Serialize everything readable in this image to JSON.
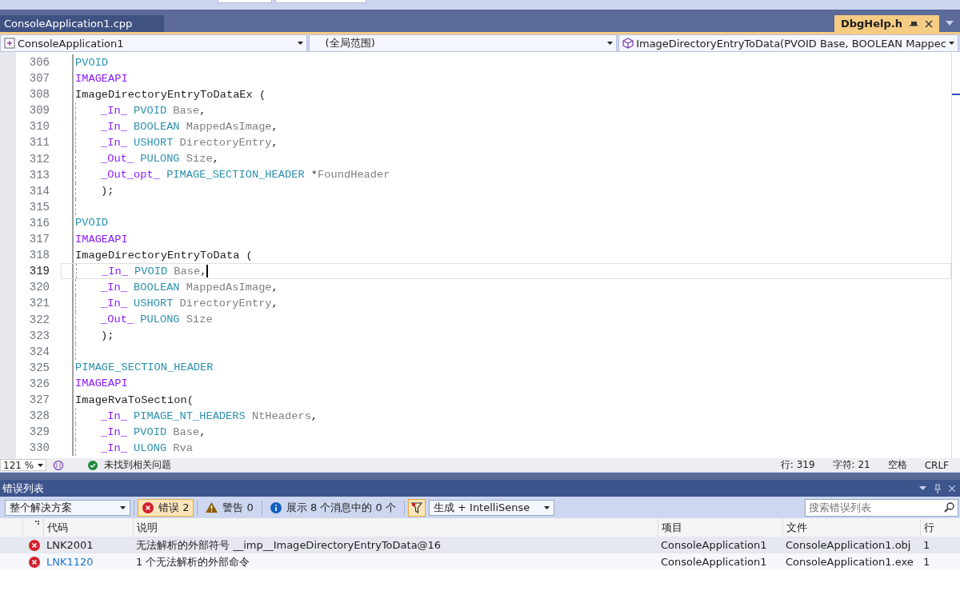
{
  "tabs": [
    {
      "label": "ConsoleApplication1.cpp",
      "selected": false
    },
    {
      "label": "DbgHelp.h",
      "selected": true
    }
  ],
  "navigation": {
    "project": "ConsoleApplication1",
    "scope": "(全局范围)",
    "member": "ImageDirectoryEntryToData(PVOID Base, BOOLEAN Mappec"
  },
  "code_lines": [
    {
      "number": "306",
      "current": false,
      "indented": false,
      "tokens": [
        {
          "kind": "type",
          "text": "PVOID"
        }
      ]
    },
    {
      "number": "307",
      "current": false,
      "indented": false,
      "tokens": [
        {
          "kind": "macro",
          "text": "IMAGEAPI"
        }
      ]
    },
    {
      "number": "308",
      "current": false,
      "indented": false,
      "tokens": [
        {
          "kind": "plain",
          "text": "ImageDirectoryEntryToDataEx ("
        }
      ]
    },
    {
      "number": "309",
      "current": false,
      "indented": true,
      "tokens": [
        {
          "kind": "macro",
          "text": "_In_"
        },
        {
          "kind": "type",
          "text": " PVOID"
        },
        {
          "kind": "param",
          "text": " Base"
        },
        {
          "kind": "plain",
          "text": ","
        }
      ]
    },
    {
      "number": "310",
      "current": false,
      "indented": true,
      "tokens": [
        {
          "kind": "macro",
          "text": "_In_"
        },
        {
          "kind": "type",
          "text": " BOOLEAN"
        },
        {
          "kind": "param",
          "text": " MappedAsImage"
        },
        {
          "kind": "plain",
          "text": ","
        }
      ]
    },
    {
      "number": "311",
      "current": false,
      "indented": true,
      "tokens": [
        {
          "kind": "macro",
          "text": "_In_"
        },
        {
          "kind": "type",
          "text": " USHORT"
        },
        {
          "kind": "param",
          "text": " DirectoryEntry"
        },
        {
          "kind": "plain",
          "text": ","
        }
      ]
    },
    {
      "number": "312",
      "current": false,
      "indented": true,
      "tokens": [
        {
          "kind": "macro",
          "text": "_Out_"
        },
        {
          "kind": "type",
          "text": " PULONG"
        },
        {
          "kind": "param",
          "text": " Size"
        },
        {
          "kind": "plain",
          "text": ","
        }
      ]
    },
    {
      "number": "313",
      "current": false,
      "indented": true,
      "tokens": [
        {
          "kind": "macro",
          "text": "_Out_opt_"
        },
        {
          "kind": "type",
          "text": " PIMAGE_SECTION_HEADER"
        },
        {
          "kind": "plain",
          "text": " *"
        },
        {
          "kind": "param",
          "text": "FoundHeader"
        }
      ]
    },
    {
      "number": "314",
      "current": false,
      "indented": true,
      "tokens": [
        {
          "kind": "plain",
          "text": ");"
        }
      ]
    },
    {
      "number": "315",
      "current": false,
      "indented": true
    },
    {
      "number": "316",
      "current": false,
      "indented": false,
      "tokens": [
        {
          "kind": "type",
          "text": "PVOID"
        }
      ]
    },
    {
      "number": "317",
      "current": false,
      "indented": false,
      "tokens": [
        {
          "kind": "macro",
          "text": "IMAGEAPI"
        }
      ]
    },
    {
      "number": "318",
      "current": false,
      "indented": false,
      "tokens": [
        {
          "kind": "plain",
          "text": "ImageDirectoryEntryToData ("
        }
      ]
    },
    {
      "number": "319",
      "current": true,
      "indented": true,
      "tokens": [
        {
          "kind": "macro",
          "text": "_In_"
        },
        {
          "kind": "type",
          "text": " PVOID"
        },
        {
          "kind": "param",
          "text": " Base"
        },
        {
          "kind": "plain",
          "text": ","
        }
      ]
    },
    {
      "number": "320",
      "current": false,
      "indented": true,
      "tokens": [
        {
          "kind": "macro",
          "text": "_In_"
        },
        {
          "kind": "type",
          "text": " BOOLEAN"
        },
        {
          "kind": "param",
          "text": " MappedAsImage"
        },
        {
          "kind": "plain",
          "text": ","
        }
      ]
    },
    {
      "number": "321",
      "current": false,
      "indented": true,
      "tokens": [
        {
          "kind": "macro",
          "text": "_In_"
        },
        {
          "kind": "type",
          "text": " USHORT"
        },
        {
          "kind": "param",
          "text": " DirectoryEntry"
        },
        {
          "kind": "plain",
          "text": ","
        }
      ]
    },
    {
      "number": "322",
      "current": false,
      "indented": true,
      "tokens": [
        {
          "kind": "macro",
          "text": "_Out_"
        },
        {
          "kind": "type",
          "text": " PULONG"
        },
        {
          "kind": "param",
          "text": " Size"
        }
      ]
    },
    {
      "number": "323",
      "current": false,
      "indented": true,
      "tokens": [
        {
          "kind": "plain",
          "text": ");"
        }
      ]
    },
    {
      "number": "324",
      "current": false,
      "indented": true
    },
    {
      "number": "325",
      "current": false,
      "indented": false,
      "tokens": [
        {
          "kind": "type",
          "text": "PIMAGE_SECTION_HEADER"
        }
      ]
    },
    {
      "number": "326",
      "current": false,
      "indented": false,
      "tokens": [
        {
          "kind": "macro",
          "text": "IMAGEAPI"
        }
      ]
    },
    {
      "number": "327",
      "current": false,
      "indented": false,
      "tokens": [
        {
          "kind": "plain",
          "text": "ImageRvaToSection("
        }
      ]
    },
    {
      "number": "328",
      "current": false,
      "indented": true,
      "tokens": [
        {
          "kind": "macro",
          "text": "_In_"
        },
        {
          "kind": "type",
          "text": " PIMAGE_NT_HEADERS"
        },
        {
          "kind": "param",
          "text": " NtHeaders"
        },
        {
          "kind": "plain",
          "text": ","
        }
      ]
    },
    {
      "number": "329",
      "current": false,
      "indented": true,
      "tokens": [
        {
          "kind": "macro",
          "text": "_In_"
        },
        {
          "kind": "type",
          "text": " PVOID"
        },
        {
          "kind": "param",
          "text": " Base"
        },
        {
          "kind": "plain",
          "text": ","
        }
      ]
    },
    {
      "number": "330",
      "current": false,
      "indented": true,
      "tokens": [
        {
          "kind": "macro",
          "text": "_In_"
        },
        {
          "kind": "type",
          "text": " ULONG"
        },
        {
          "kind": "param",
          "text": " Rva"
        }
      ]
    }
  ],
  "editor_status": {
    "zoom": "121 %",
    "issues": "未找到相关问题",
    "line": "行: 319",
    "char": "字符: 21",
    "whitespace": "空格",
    "line_ending": "CRLF"
  },
  "error_list": {
    "title": "错误列表",
    "scope": "整个解决方案",
    "filters": [
      {
        "kind": "error",
        "label": "错误 2",
        "selected": true
      },
      {
        "kind": "warning",
        "label": "警告 0",
        "selected": false
      },
      {
        "kind": "info",
        "label": "展示 8 个消息中的 0 个",
        "selected": false
      }
    ],
    "source": "生成 + IntelliSense",
    "search": {
      "placeholder": "搜索错误列表"
    },
    "columns": [
      "代码",
      "说明",
      "项目",
      "文件",
      "行"
    ],
    "rows": [
      {
        "code": "LNK2001",
        "link": false,
        "description": "无法解析的外部符号 __imp__ImageDirectoryEntryToData@16",
        "project": "ConsoleApplication1",
        "file": "ConsoleApplication1.obj",
        "line": "1",
        "selected": true
      },
      {
        "code": "LNK1120",
        "link": true,
        "description": "1 个无法解析的外部命令",
        "project": "ConsoleApplication1",
        "file": "ConsoleApplication1.exe",
        "line": "1",
        "selected": false
      }
    ]
  }
}
